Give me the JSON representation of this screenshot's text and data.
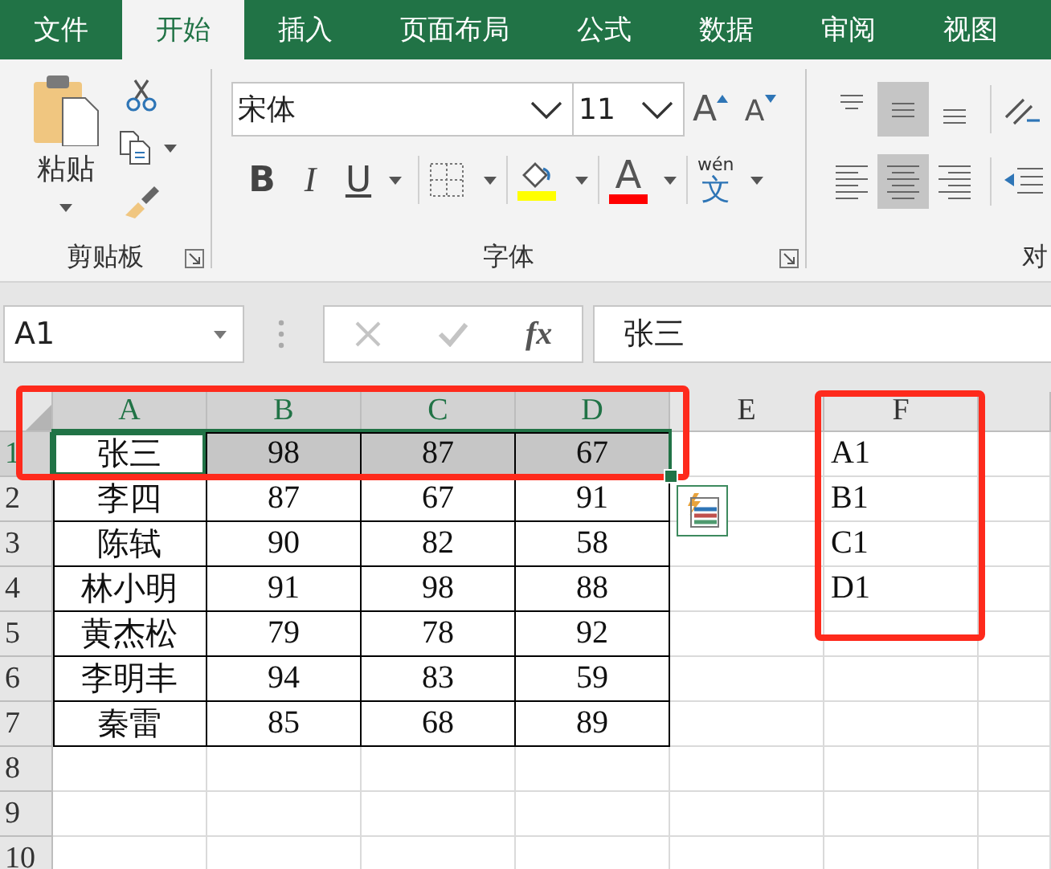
{
  "tabs": [
    {
      "label": "文件",
      "selected": false
    },
    {
      "label": "开始",
      "selected": true
    },
    {
      "label": "插入",
      "selected": false
    },
    {
      "label": "页面布局",
      "selected": false
    },
    {
      "label": "公式",
      "selected": false
    },
    {
      "label": "数据",
      "selected": false
    },
    {
      "label": "审阅",
      "selected": false
    },
    {
      "label": "视图",
      "selected": false
    }
  ],
  "ribbon": {
    "groups": [
      {
        "kind": "clipboard",
        "label": "剪贴板",
        "launcher": true,
        "paste_label": "粘贴"
      },
      {
        "kind": "font",
        "label": "字体",
        "launcher": true,
        "font_name": "宋体",
        "font_size": "11",
        "grow": "A",
        "shrink": "A",
        "bold": "B",
        "italic": "I",
        "underline": "U",
        "font_color": "A",
        "phonetic_reading": "wén",
        "phonetic_char": "文"
      },
      {
        "kind": "alignment",
        "label": "对",
        "vertical": [
          {
            "kind": "top",
            "selected": false
          },
          {
            "kind": "middle",
            "selected": true
          },
          {
            "kind": "bottom",
            "selected": false
          }
        ],
        "horizontal": [
          {
            "kind": "left",
            "selected": false
          },
          {
            "kind": "center",
            "selected": true
          },
          {
            "kind": "right",
            "selected": false
          }
        ]
      }
    ]
  },
  "formula_bar": {
    "name_box": "A1",
    "function_label": "fx",
    "formula": "张三"
  },
  "sheet": {
    "columns": [
      {
        "label": "A",
        "selected": true
      },
      {
        "label": "B",
        "selected": true
      },
      {
        "label": "C",
        "selected": true
      },
      {
        "label": "D",
        "selected": true
      },
      {
        "label": "E",
        "selected": false
      },
      {
        "label": "F",
        "selected": false
      }
    ],
    "rows": [
      {
        "label": "1",
        "selected": true,
        "cells": [
          {
            "text": "张三",
            "active": true
          },
          {
            "text": "98",
            "selected": true,
            "active": false
          },
          {
            "text": "87",
            "selected": true,
            "active": false
          },
          {
            "text": "67",
            "selected": true,
            "active": false
          }
        ],
        "column_f": "A1"
      },
      {
        "label": "2",
        "selected": false,
        "cells": [
          {
            "text": "李四",
            "selected": false
          },
          {
            "text": "87",
            "selected": false
          },
          {
            "text": "67",
            "selected": false
          },
          {
            "text": "91",
            "selected": false
          }
        ],
        "column_f": "B1"
      },
      {
        "label": "3",
        "selected": false,
        "cells": [
          {
            "text": "陈轼",
            "selected": false
          },
          {
            "text": "90",
            "selected": false
          },
          {
            "text": "82",
            "selected": false
          },
          {
            "text": "58",
            "selected": false
          }
        ],
        "column_f": "C1"
      },
      {
        "label": "4",
        "selected": false,
        "cells": [
          {
            "text": "林小明",
            "selected": false
          },
          {
            "text": "91",
            "selected": false
          },
          {
            "text": "98",
            "selected": false
          },
          {
            "text": "88",
            "selected": false
          }
        ],
        "column_f": "D1"
      },
      {
        "label": "5",
        "selected": false,
        "cells": [
          {
            "text": "黄杰松",
            "selected": false
          },
          {
            "text": "79",
            "selected": false
          },
          {
            "text": "78",
            "selected": false
          },
          {
            "text": "92",
            "selected": false
          }
        ]
      },
      {
        "label": "6",
        "selected": false,
        "cells": [
          {
            "text": "李明丰",
            "selected": false
          },
          {
            "text": "94",
            "selected": false
          },
          {
            "text": "83",
            "selected": false
          },
          {
            "text": "59",
            "selected": false
          }
        ]
      },
      {
        "label": "7",
        "selected": false,
        "cells": [
          {
            "text": "秦雷",
            "selected": false
          },
          {
            "text": "85",
            "selected": false
          },
          {
            "text": "68",
            "selected": false
          },
          {
            "text": "89",
            "selected": false
          }
        ]
      },
      {
        "label": "8",
        "selected": false
      },
      {
        "label": "9",
        "selected": false
      },
      {
        "label": "10",
        "selected": false
      }
    ]
  }
}
